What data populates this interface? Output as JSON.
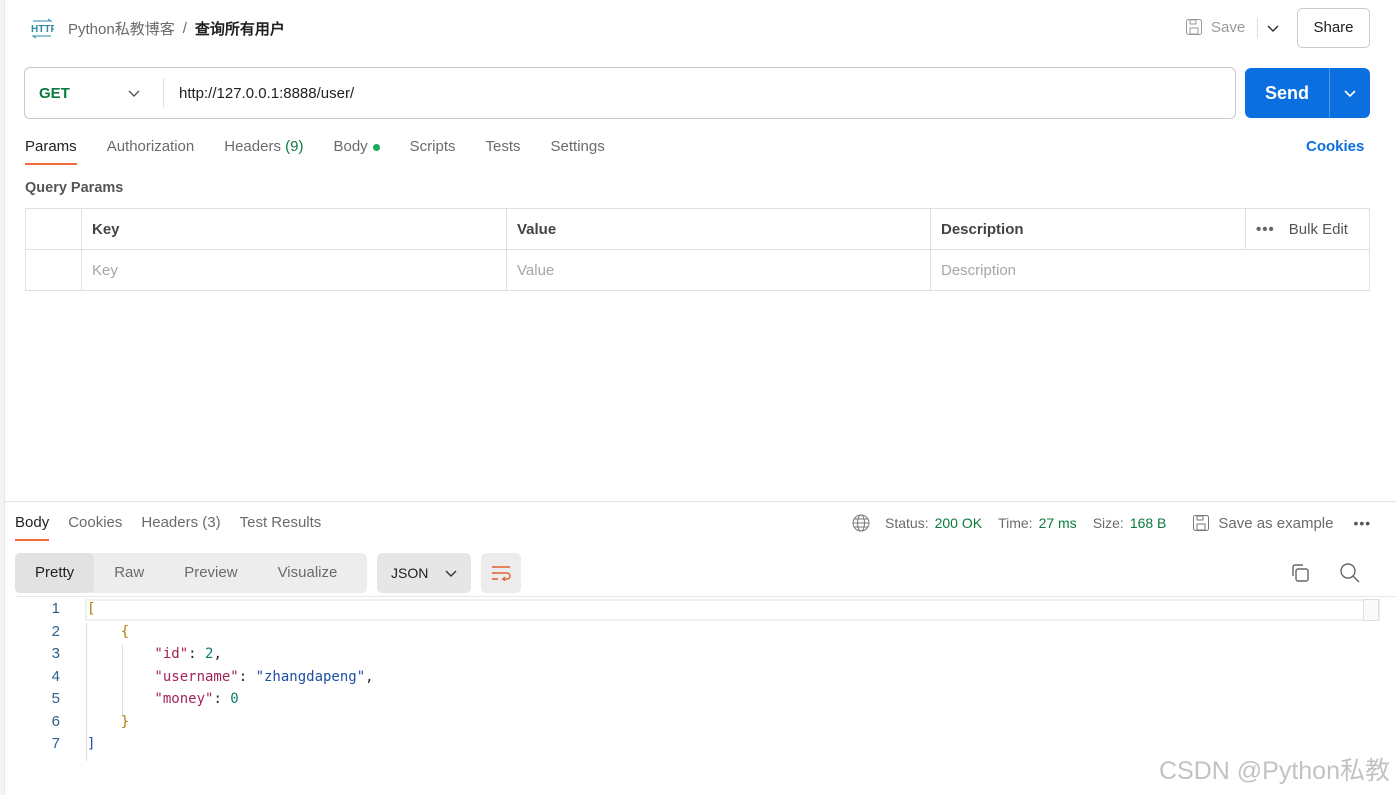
{
  "header": {
    "workspace": "Python私教博客",
    "separator": "/",
    "request_name": "查询所有用户",
    "save_label": "Save",
    "share_label": "Share"
  },
  "request": {
    "method": "GET",
    "url": "http://127.0.0.1:8888/user/",
    "send_label": "Send"
  },
  "tabs": [
    {
      "label": "Params"
    },
    {
      "label": "Authorization"
    },
    {
      "label": "Headers",
      "count": "(9)"
    },
    {
      "label": "Body"
    },
    {
      "label": "Scripts"
    },
    {
      "label": "Tests"
    },
    {
      "label": "Settings"
    }
  ],
  "cookies_label": "Cookies",
  "query_params": {
    "title": "Query Params",
    "columns": [
      "Key",
      "Value",
      "Description"
    ],
    "bulk_edit": "Bulk Edit",
    "placeholders": [
      "Key",
      "Value",
      "Description"
    ]
  },
  "response": {
    "tabs": [
      {
        "label": "Body"
      },
      {
        "label": "Cookies"
      },
      {
        "label": "Headers (3)"
      },
      {
        "label": "Test Results"
      }
    ],
    "status_label": "Status:",
    "status": "200 OK",
    "time_label": "Time:",
    "time": "27 ms",
    "size_label": "Size:",
    "size": "168 B",
    "save_example": "Save as example",
    "views": [
      "Pretty",
      "Raw",
      "Preview",
      "Visualize"
    ],
    "format": "JSON",
    "lines": [
      [
        {
          "t": "[",
          "c": "b"
        }
      ],
      [
        {
          "t": "    {",
          "c": "b"
        }
      ],
      [
        {
          "t": "        \"id\"",
          "c": "k"
        },
        {
          "t": ": ",
          "c": "p"
        },
        {
          "t": "2",
          "c": "n"
        },
        {
          "t": ",",
          "c": "p"
        }
      ],
      [
        {
          "t": "        \"username\"",
          "c": "k"
        },
        {
          "t": ": ",
          "c": "p"
        },
        {
          "t": "\"zhangdapeng\"",
          "c": "s"
        },
        {
          "t": ",",
          "c": "p"
        }
      ],
      [
        {
          "t": "        \"money\"",
          "c": "k"
        },
        {
          "t": ": ",
          "c": "p"
        },
        {
          "t": "0",
          "c": "n"
        }
      ],
      [
        {
          "t": "    }",
          "c": "b"
        }
      ],
      [
        {
          "t": "]",
          "c": "s"
        }
      ]
    ]
  },
  "watermark": "CSDN @Python私教",
  "colors": {
    "accent": "#0b6fe0",
    "status_green": "#0b7a3e",
    "tab_underline": "#f26b3a"
  }
}
